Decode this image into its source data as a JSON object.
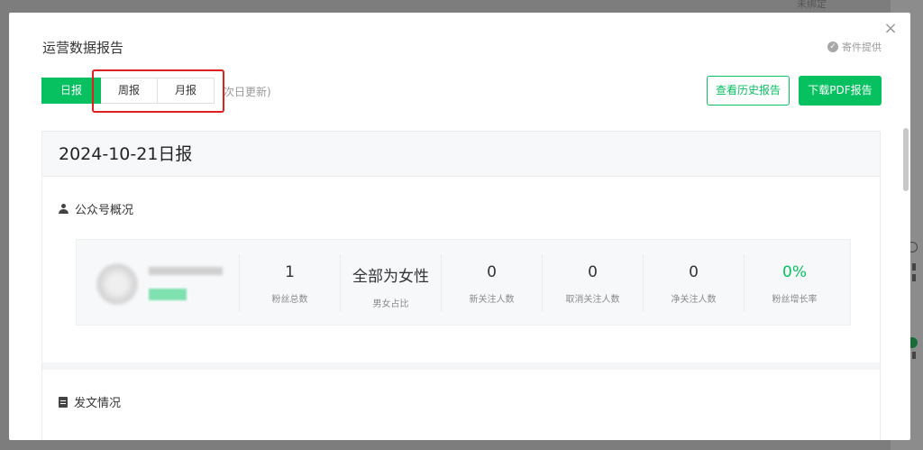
{
  "background": {
    "top_text": "未绑定"
  },
  "modal": {
    "title": "运营数据报告",
    "provider": "寄件提供",
    "tabs": [
      {
        "label": "日报",
        "active": true
      },
      {
        "label": "周报",
        "active": false
      },
      {
        "label": "月报",
        "active": false
      }
    ],
    "tab_note": "次日更新)",
    "history_button": "查看历史报告",
    "download_button": "下载PDF报告"
  },
  "report": {
    "heading": "2024-10-21日报",
    "overview_title": "公众号概况",
    "stats": [
      {
        "value": "1",
        "label": "粉丝总数",
        "green": false
      },
      {
        "value": "全部为女性",
        "label": "男女占比",
        "green": false
      },
      {
        "value": "0",
        "label": "新关注人数",
        "green": false
      },
      {
        "value": "0",
        "label": "取消关注人数",
        "green": false
      },
      {
        "value": "0",
        "label": "净关注人数",
        "green": false
      },
      {
        "value": "0%",
        "label": "粉丝增长率",
        "green": true
      }
    ],
    "articles_title": "发文情况"
  },
  "colors": {
    "brand_green": "#07c160",
    "highlight_red": "#e02020"
  }
}
